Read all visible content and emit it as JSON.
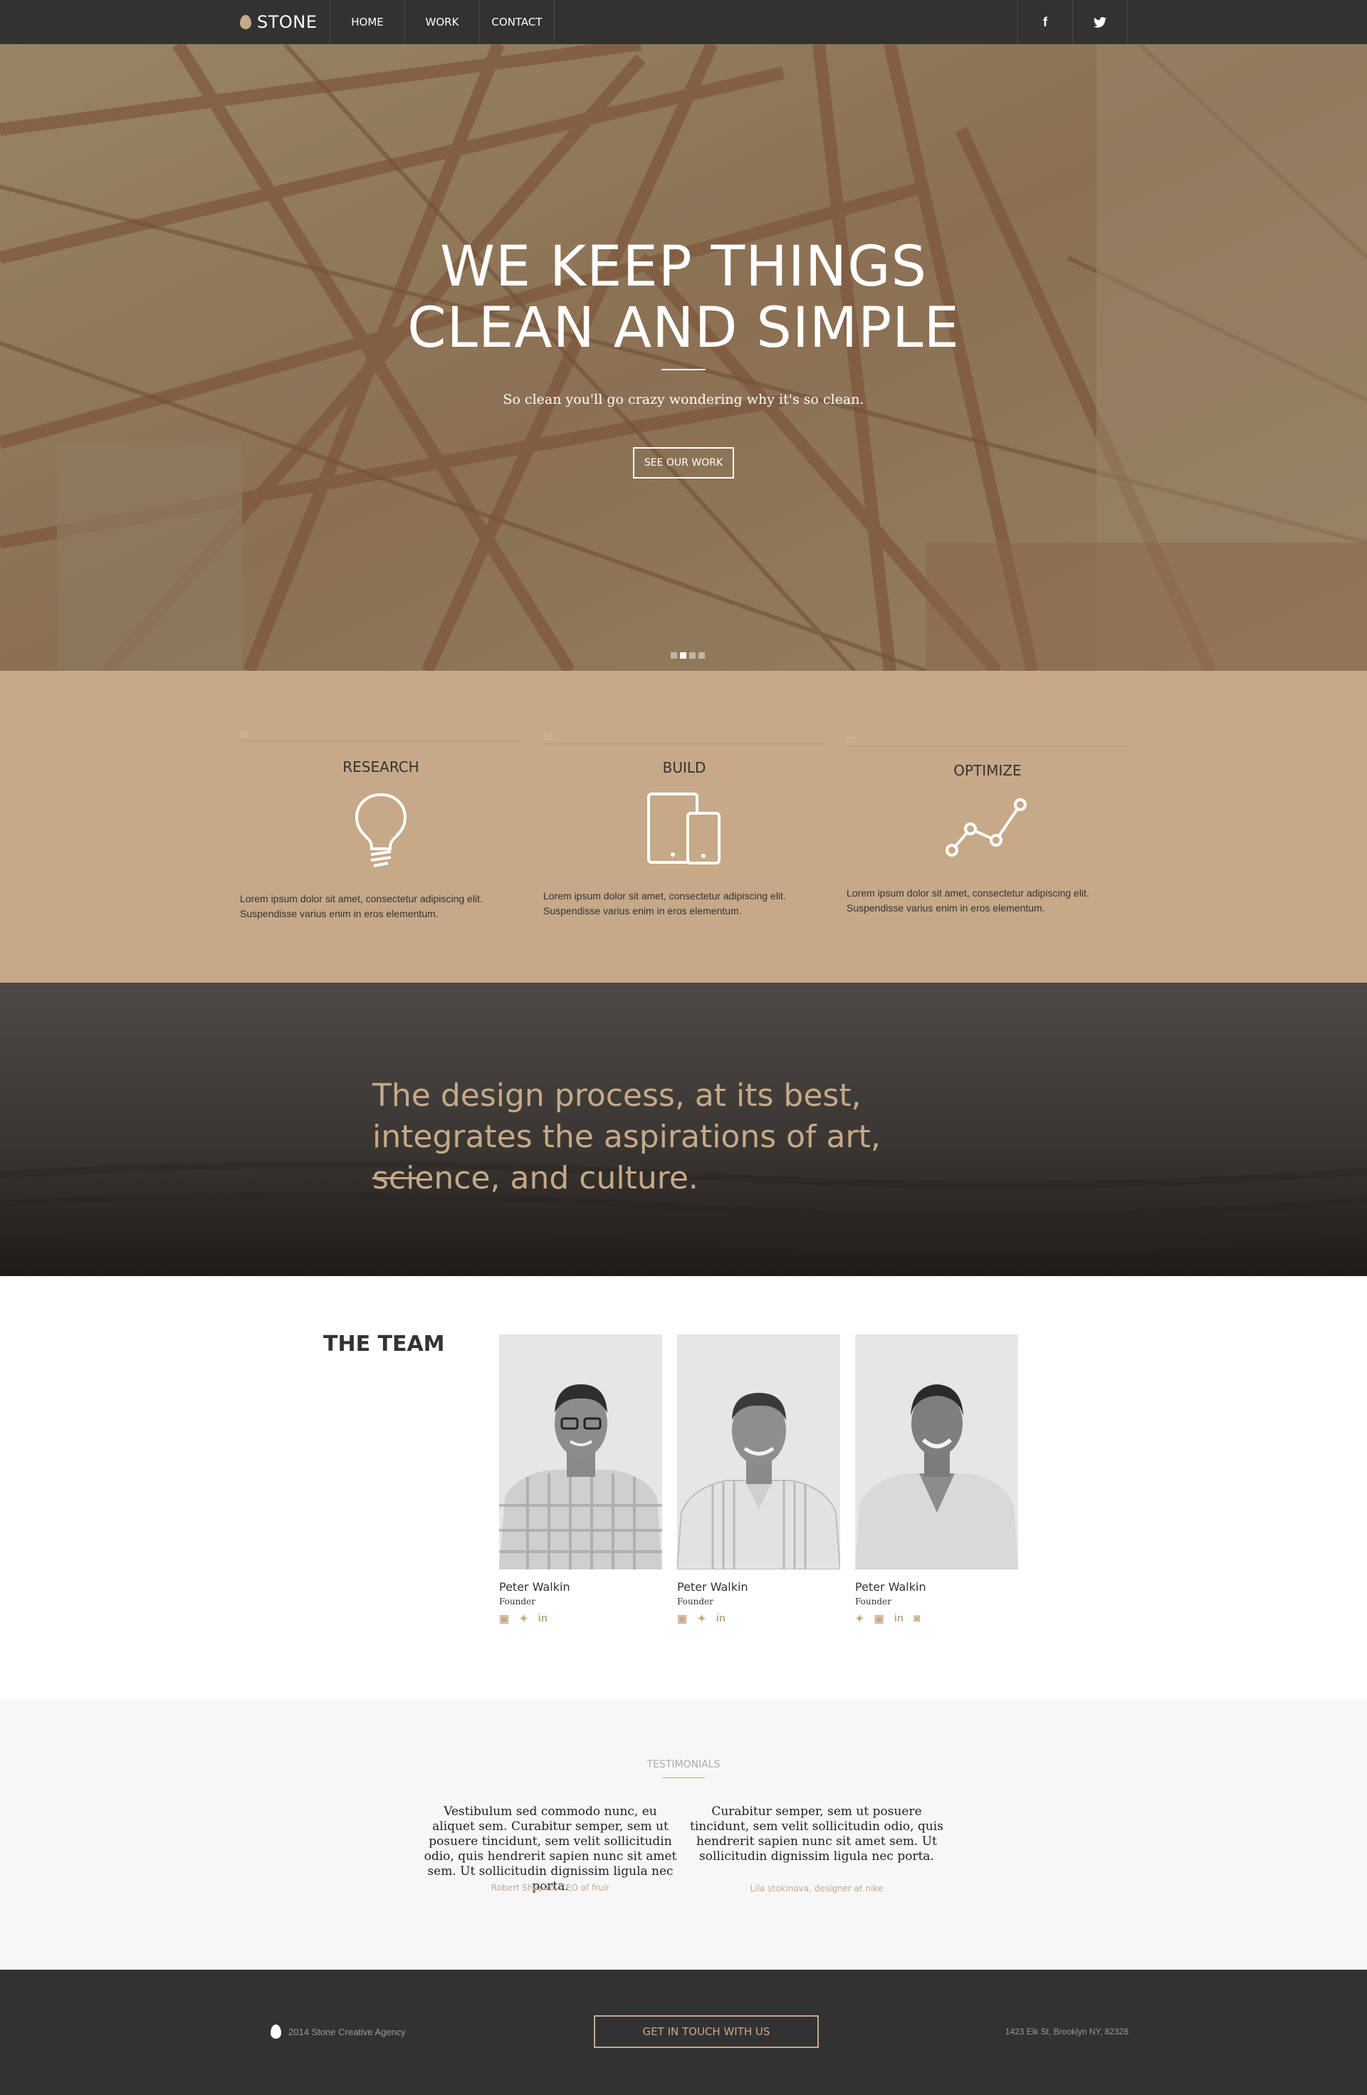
{
  "nav": {
    "brand": "STONE",
    "items": [
      "HOME",
      "WORK",
      "CONTACT"
    ],
    "social": [
      "f",
      "t"
    ]
  },
  "hero": {
    "title_line1": "WE KEEP THINGS",
    "title_line2": "CLEAN AND SIMPLE",
    "subtitle": "So clean you'll go crazy wondering why it's so clean.",
    "cta": "SEE OUR WORK"
  },
  "features": [
    {
      "num": "01",
      "title": "RESEARCH",
      "icon": "lightbulb-icon",
      "text": "Lorem ipsum dolor sit amet, consectetur adipiscing elit. Suspendisse varius enim in eros elementum."
    },
    {
      "num": "02",
      "title": "BUILD",
      "icon": "devices-icon",
      "text": "Lorem ipsum dolor sit amet, consectetur adipiscing elit. Suspendisse varius enim in eros elementum."
    },
    {
      "num": "03",
      "title": "OPTIMIZE",
      "icon": "line-chart-icon",
      "text": "Lorem ipsum dolor sit amet, consectetur adipiscing elit. Suspendisse varius enim in eros elementum."
    }
  ],
  "quote": {
    "text": "The design process, at its best, integrates the aspirations of art, science, and culture."
  },
  "team": {
    "title": "THE TEAM",
    "members": [
      {
        "name": "Peter Walkin",
        "role": "Founder",
        "icons": [
          "facebook-icon",
          "twitter-icon",
          "linkedin-icon"
        ]
      },
      {
        "name": "Peter Walkin",
        "role": "Founder",
        "icons": [
          "facebook-icon",
          "twitter-icon",
          "linkedin-icon"
        ]
      },
      {
        "name": "Peter Walkin",
        "role": "Founder",
        "icons": [
          "twitter-icon",
          "facebook-icon",
          "linkedin-icon",
          "instagram-icon"
        ]
      }
    ]
  },
  "testimonials": {
    "label": "TESTIMONIALS",
    "items": [
      {
        "text": "Vestibulum sed commodo nunc, eu aliquet sem. Curabitur semper, sem ut posuere tincidunt, sem velit sollicitudin odio, quis hendrerit sapien nunc sit amet sem. Ut sollicitudin dignissim ligula nec porta.",
        "author": "Robert Shapiro, CEO of fruir"
      },
      {
        "text": "Curabitur semper, sem ut posuere tincidunt, sem velit sollicitudin odio, quis hendrerit sapien nunc sit amet sem. Ut sollicitudin dignissim ligula nec porta.",
        "author": "Lila stokinova, designer at nike"
      }
    ]
  },
  "footer": {
    "copyright": "2014 Stone Creative Agency",
    "cta": "GET IN TOUCH WITH US",
    "address": "1423 Elk St, Brooklyn NY, 82328"
  },
  "colors": {
    "accent": "#c6a988",
    "dark": "#323232"
  }
}
